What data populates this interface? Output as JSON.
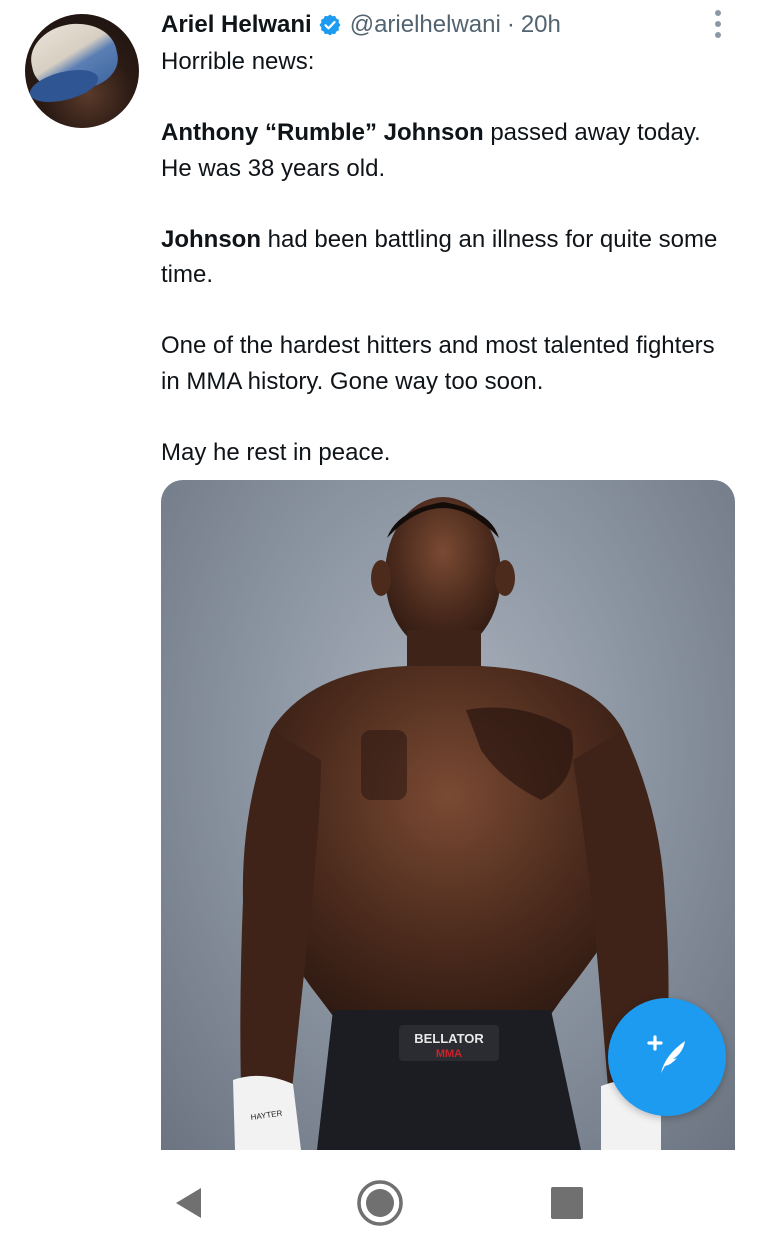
{
  "tweet": {
    "display_name": "Ariel Helwani",
    "handle": "@arielhelwani",
    "separator": "·",
    "time": "20h",
    "paragraphs": [
      [
        {
          "text": "Horrible news:",
          "bold": false
        }
      ],
      [
        {
          "text": "Anthony “Rumble” Johnson",
          "bold": true
        },
        {
          "text": " passed away today. He was 38 years old.",
          "bold": false
        }
      ],
      [
        {
          "text": "Johnson",
          "bold": true
        },
        {
          "text": " had been battling an illness for quite some time.",
          "bold": false
        }
      ],
      [
        {
          "text": "One of the hardest hitters and most talented fighters in MMA history. Gone way too soon.",
          "bold": false
        }
      ],
      [
        {
          "text": "May he rest in peace.",
          "bold": false
        }
      ]
    ],
    "media": {
      "waistband_text_1": "BELLATOR",
      "waistband_text_2": "MMA",
      "glove_text": "HAYTER"
    },
    "icons": {
      "verified": "verified-badge-icon",
      "more": "more-vertical-icon"
    }
  },
  "fab": {
    "icon": "compose-tweet-icon",
    "color": "#1d9bf0"
  },
  "navbar": {
    "back": "back-triangle-icon",
    "home": "home-circle-icon",
    "recents": "recents-square-icon"
  },
  "colors": {
    "accent": "#1d9bf0",
    "text": "#0f1419",
    "secondary": "#536471"
  }
}
